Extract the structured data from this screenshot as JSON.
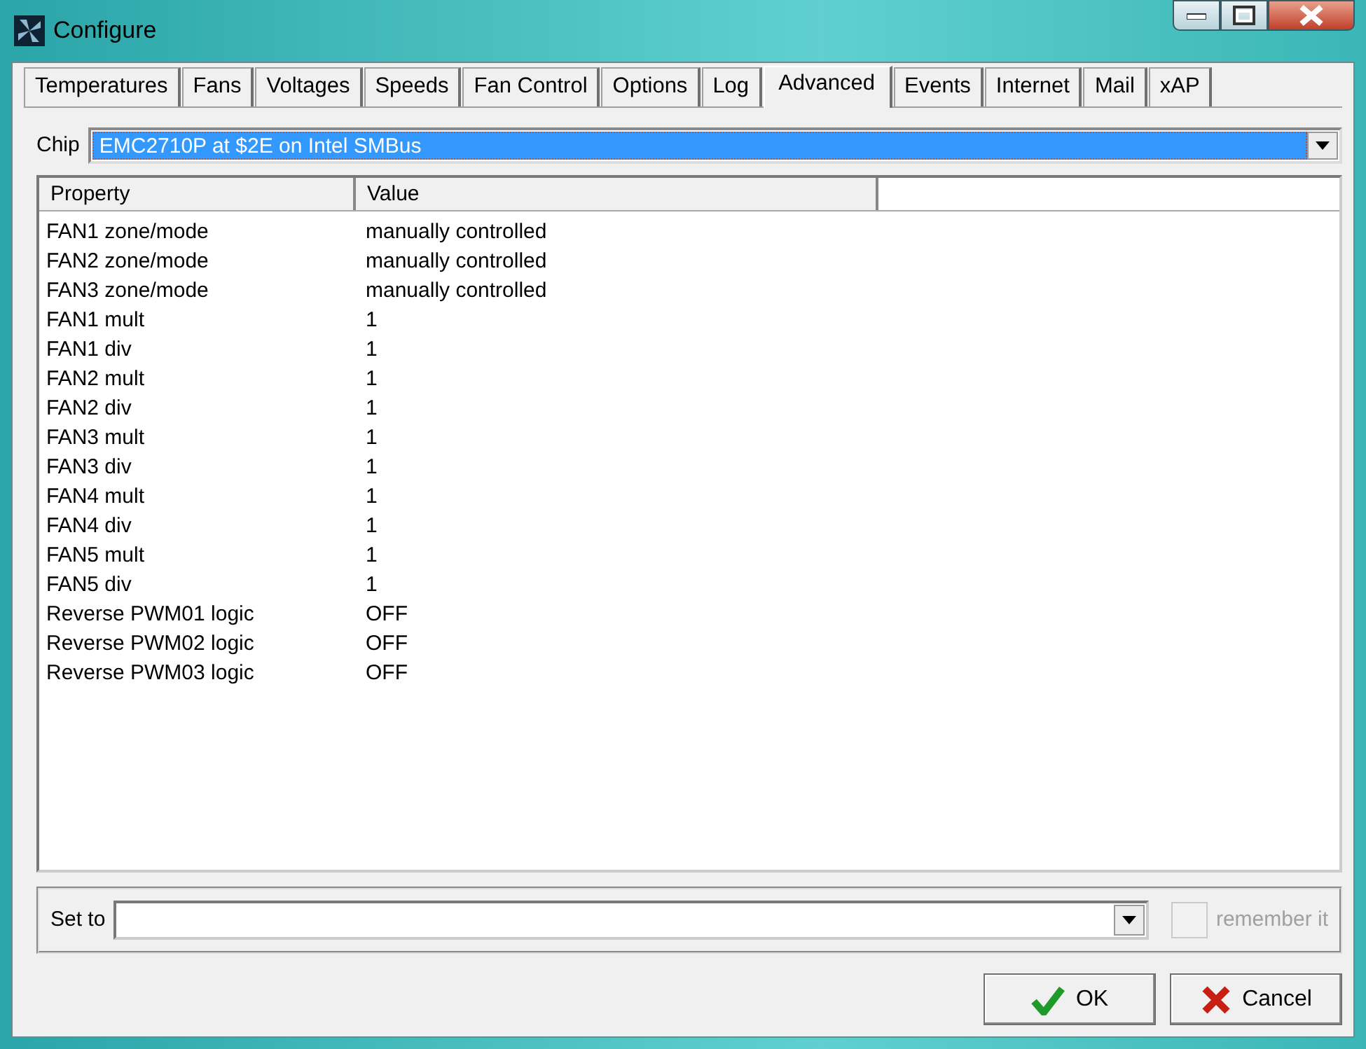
{
  "window": {
    "title": "Configure"
  },
  "tabs": [
    {
      "label": "Temperatures",
      "selected": false
    },
    {
      "label": "Fans",
      "selected": false
    },
    {
      "label": "Voltages",
      "selected": false
    },
    {
      "label": "Speeds",
      "selected": false
    },
    {
      "label": "Fan Control",
      "selected": false
    },
    {
      "label": "Options",
      "selected": false
    },
    {
      "label": "Log",
      "selected": false
    },
    {
      "label": "Advanced",
      "selected": true
    },
    {
      "label": "Events",
      "selected": false
    },
    {
      "label": "Internet",
      "selected": false
    },
    {
      "label": "Mail",
      "selected": false
    },
    {
      "label": "xAP",
      "selected": false
    }
  ],
  "chip": {
    "label": "Chip",
    "value": "EMC2710P at $2E on Intel SMBus"
  },
  "table": {
    "columns": [
      "Property",
      "Value"
    ],
    "rows": [
      [
        "FAN1 zone/mode",
        "manually controlled"
      ],
      [
        "FAN2 zone/mode",
        "manually controlled"
      ],
      [
        "FAN3 zone/mode",
        "manually controlled"
      ],
      [
        "FAN1 mult",
        "1"
      ],
      [
        "FAN1 div",
        "1"
      ],
      [
        "FAN2 mult",
        "1"
      ],
      [
        "FAN2 div",
        "1"
      ],
      [
        "FAN3 mult",
        "1"
      ],
      [
        "FAN3 div",
        "1"
      ],
      [
        "FAN4 mult",
        "1"
      ],
      [
        "FAN4 div",
        "1"
      ],
      [
        "FAN5 mult",
        "1"
      ],
      [
        "FAN5 div",
        "1"
      ],
      [
        "Reverse PWM01 logic",
        "OFF"
      ],
      [
        "Reverse PWM02 logic",
        "OFF"
      ],
      [
        "Reverse PWM03 logic",
        "OFF"
      ]
    ]
  },
  "set_to": {
    "label": "Set to"
  },
  "remember": {
    "label": "remember it",
    "checked": false,
    "disabled": true
  },
  "buttons": [
    {
      "label": "OK",
      "kind": "ok"
    },
    {
      "label": "Cancel",
      "kind": "cancel"
    }
  ]
}
